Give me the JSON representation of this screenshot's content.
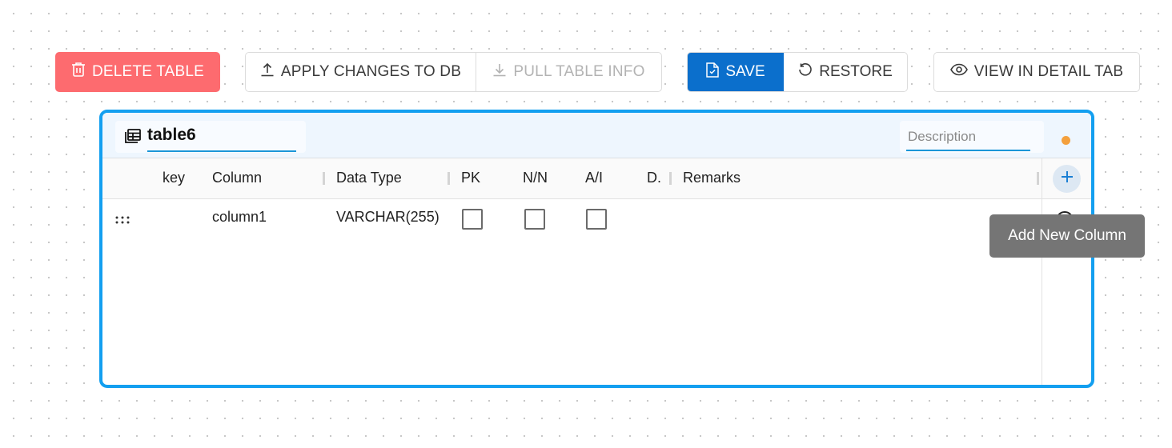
{
  "toolbar": {
    "delete_label": "DELETE TABLE",
    "apply_label": "APPLY CHANGES TO DB",
    "pull_label": "PULL TABLE INFO",
    "save_label": "SAVE",
    "restore_label": "RESTORE",
    "view_label": "VIEW IN DETAIL TAB"
  },
  "table": {
    "name": "table6",
    "description_placeholder": "Description",
    "columns_header": {
      "key": "key",
      "column": "Column",
      "data_type": "Data Type",
      "pk": "PK",
      "nn": "N/N",
      "ai": "A/I",
      "d": "D.",
      "remarks": "Remarks"
    },
    "rows": [
      {
        "key": "",
        "column": "column1",
        "data_type": "VARCHAR(255)",
        "pk": false,
        "nn": false,
        "ai": false,
        "remarks": ""
      }
    ]
  },
  "tooltip": {
    "text": "Add New Column"
  },
  "colors": {
    "delete": "#fd6b6f",
    "primary": "#0b6fcc",
    "card_border": "#139ff0",
    "status_dot": "#f4a03d",
    "tooltip_bg": "#757575"
  },
  "icons": {
    "delete": "trash-icon",
    "apply": "upload-icon",
    "pull": "download-icon",
    "save": "save-file-icon",
    "restore": "restore-icon",
    "view": "eye-icon",
    "table": "table-icon",
    "add_column": "plus-icon",
    "drag": "drag-handle-icon"
  }
}
